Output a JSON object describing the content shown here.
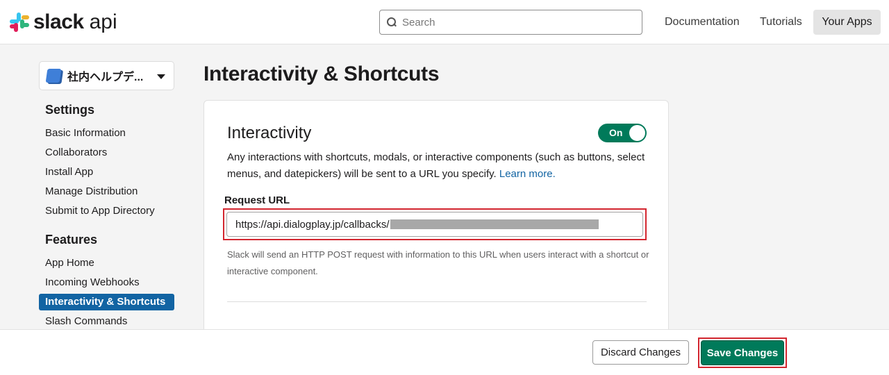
{
  "header": {
    "logo_word": "slack",
    "logo_suffix": "api",
    "search_placeholder": "Search",
    "nav": [
      "Documentation",
      "Tutorials",
      "Your Apps"
    ]
  },
  "sidebar": {
    "workspace": "社内ヘルプデ...",
    "settings_heading": "Settings",
    "settings_items": [
      "Basic Information",
      "Collaborators",
      "Install App",
      "Manage Distribution",
      "Submit to App Directory"
    ],
    "features_heading": "Features",
    "features_items": [
      "App Home",
      "Incoming Webhooks",
      "Interactivity & Shortcuts",
      "Slash Commands"
    ],
    "active_item": "Interactivity & Shortcuts"
  },
  "main": {
    "page_title": "Interactivity & Shortcuts",
    "section_title": "Interactivity",
    "toggle_label": "On",
    "description": "Any interactions with shortcuts, modals, or interactive components (such as buttons, select menus, and datepickers) will be sent to a URL you specify.",
    "learn_more": "Learn more.",
    "request_url_label": "Request URL",
    "request_url_value": "https://api.dialogplay.jp/callbacks/",
    "helper_text": "Slack will send an HTTP POST request with information to this URL when users interact with a shortcut or interactive component."
  },
  "footer": {
    "discard_label": "Discard Changes",
    "save_label": "Save Changes"
  },
  "colors": {
    "accent_green": "#007a5a",
    "active_blue": "#1264a3",
    "highlight_red": "#d3262f"
  }
}
